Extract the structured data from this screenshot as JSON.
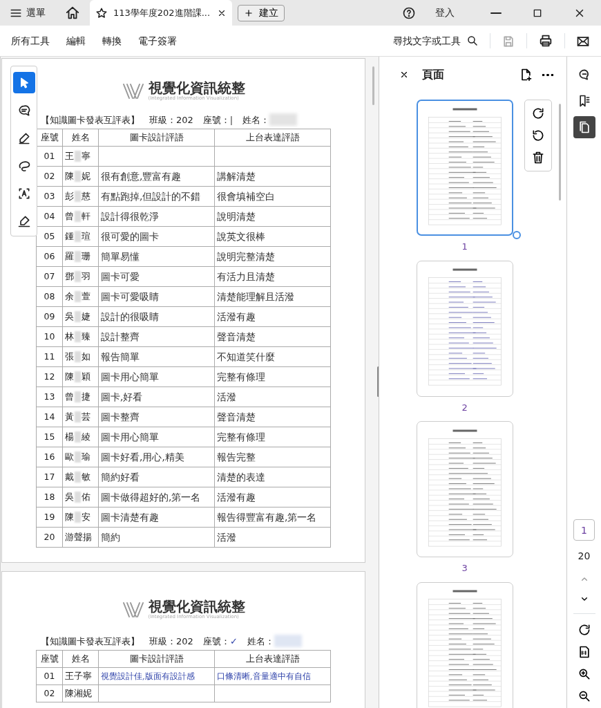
{
  "tabbar": {
    "menu": "選單",
    "tab_title": "113學年度202進階課...",
    "new_button": "建立",
    "signin": "登入"
  },
  "toolbar": {
    "items": [
      "所有工具",
      "編輯",
      "轉換",
      "電子簽署"
    ],
    "search": "尋找文字或工具"
  },
  "tools": [
    {
      "kind": "pointer",
      "selected": true
    },
    {
      "kind": "comment",
      "selected": false
    },
    {
      "kind": "pen",
      "selected": false
    },
    {
      "kind": "lasso",
      "selected": false
    },
    {
      "kind": "textselect",
      "selected": false
    },
    {
      "kind": "sign",
      "selected": false
    }
  ],
  "document": {
    "pages": [
      {
        "kind": "pencil",
        "logo": "視覺化資訊統整",
        "logo_sub": "(Integrated Information Visualization)",
        "form_title": "【知識圖卡發表互評表】",
        "class_label": "班級：202",
        "seat_label": "座號：",
        "seat_mark": "|",
        "name_label": "姓名：",
        "columns": [
          "座號",
          "姓名",
          "圖卡設計評語",
          "上台表達評語"
        ],
        "rows": [
          {
            "seat": "01",
            "name": [
              "王",
              "寧"
            ]
          },
          {
            "seat": "02",
            "name": [
              "陳",
              "妮"
            ],
            "design": "很有創意,豐富有趣",
            "speech": "講解清楚"
          },
          {
            "seat": "03",
            "name": [
              "彭",
              "慈"
            ],
            "design": "有點跑掉,但設計的不錯",
            "speech": "很會填補空白"
          },
          {
            "seat": "04",
            "name": [
              "曾",
              "軒"
            ],
            "design": "設計得很乾淨",
            "speech": "說明清楚"
          },
          {
            "seat": "05",
            "name": [
              "鍾",
              "瑄"
            ],
            "design": "很可愛的圖卡",
            "speech": "說英文很棒"
          },
          {
            "seat": "06",
            "name": [
              "羅",
              "珊"
            ],
            "design": "簡單易懂",
            "speech": "說明完整清楚"
          },
          {
            "seat": "07",
            "name": [
              "鄧",
              "羽"
            ],
            "design": "圖卡可愛",
            "speech": "有活力且清楚"
          },
          {
            "seat": "08",
            "name": [
              "余",
              "萱"
            ],
            "design": "圖卡可愛吸睛",
            "speech": "清楚能理解且活潑"
          },
          {
            "seat": "09",
            "name": [
              "吳",
              "婕"
            ],
            "design": "設計的很吸睛",
            "speech": "活潑有趣"
          },
          {
            "seat": "10",
            "name": [
              "林",
              "臻"
            ],
            "design": "設計整齊",
            "speech": "聲音清楚"
          },
          {
            "seat": "11",
            "name": [
              "張",
              "如"
            ],
            "design": "報告簡單",
            "speech": "不知道笑什麼"
          },
          {
            "seat": "12",
            "name": [
              "陳",
              "穎"
            ],
            "design": "圖卡用心簡單",
            "speech": "完整有條理"
          },
          {
            "seat": "13",
            "name": [
              "曾",
              "捷"
            ],
            "design": "圖卡,好看",
            "speech": "活潑"
          },
          {
            "seat": "14",
            "name": [
              "黃",
              "芸"
            ],
            "design": "圖卡整齊",
            "speech": "聲音清楚"
          },
          {
            "seat": "15",
            "name": [
              "楊",
              "綾"
            ],
            "design": "圖卡用心簡單",
            "speech": "完整有條理"
          },
          {
            "seat": "16",
            "name": [
              "歐",
              "瑜"
            ],
            "design": "圖卡好看,用心,精美",
            "speech": "報告完整"
          },
          {
            "seat": "17",
            "name": [
              "戴",
              "敏"
            ],
            "design": "簡約好看",
            "speech": "清楚的表達"
          },
          {
            "seat": "18",
            "name": [
              "吳",
              "佑"
            ],
            "design": "圖卡做得超好的,第一名",
            "speech": "活潑有趣"
          },
          {
            "seat": "19",
            "name": [
              "陳",
              "安"
            ],
            "design": "圖卡清楚有趣",
            "speech": "報告得豐富有趣,第一名"
          },
          {
            "seat": "20",
            "name": [
              "游聲揚"
            ],
            "design": "簡約",
            "speech": "活潑"
          }
        ]
      },
      {
        "kind": "pen",
        "logo": "視覺化資訊統整",
        "logo_sub": "(Integrated Information Visualization)",
        "form_title": "【知識圖卡發表互評表】",
        "class_label": "班級：202",
        "seat_label": "座號：",
        "seat_mark": "✓",
        "name_label": "姓名：",
        "columns": [
          "座號",
          "姓名",
          "圖卡設計評語",
          "上台表達評語"
        ],
        "rows": [
          {
            "seat": "01",
            "name": [
              "王子寧"
            ],
            "design": "視覺設計佳,版面有設計感",
            "speech": "口條清晰,音量適中有自信"
          },
          {
            "seat": "02",
            "name": [
              "陳湘妮"
            ]
          }
        ]
      }
    ]
  },
  "pages_panel": {
    "title": "頁面",
    "thumbnails": [
      {
        "label": "1",
        "selected": true
      },
      {
        "label": "2",
        "selected": false
      },
      {
        "label": "3",
        "selected": false
      },
      {
        "selected": false
      }
    ]
  },
  "rail": {
    "icons": [
      {
        "kind": "comments",
        "selected": false
      },
      {
        "kind": "bookmarks",
        "selected": false
      },
      {
        "kind": "pages",
        "selected": true
      }
    ],
    "page_input": "1",
    "page_total": "20"
  }
}
